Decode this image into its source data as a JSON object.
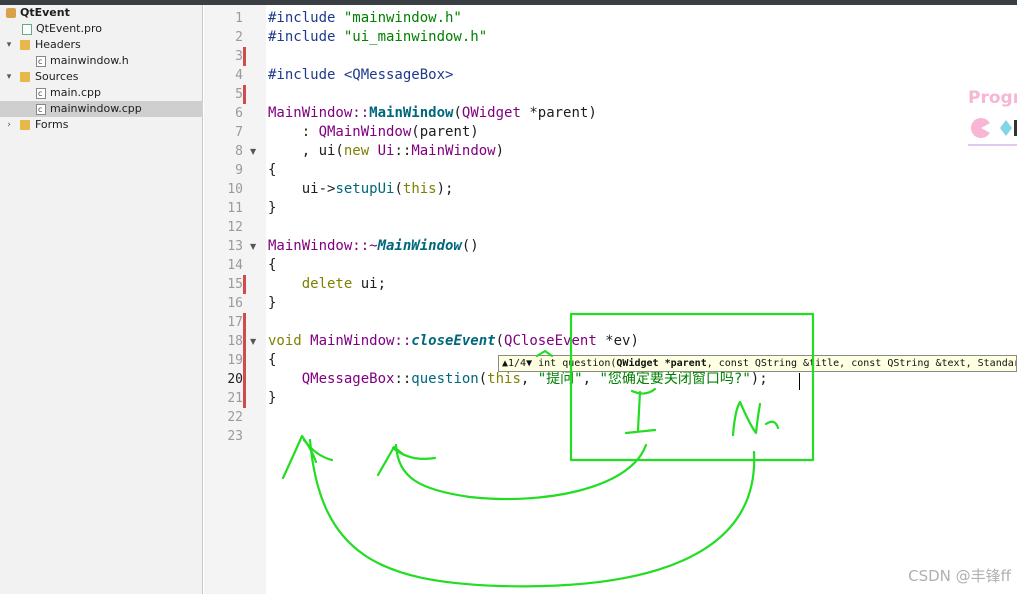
{
  "project_tree": {
    "project": "QtEvent",
    "pro_file": "QtEvent.pro",
    "headers_label": "Headers",
    "header_file": "mainwindow.h",
    "sources_label": "Sources",
    "source_main": "main.cpp",
    "source_mainwindow": "mainwindow.cpp",
    "forms_label": "Forms"
  },
  "line_numbers": [
    "1",
    "2",
    "3",
    "4",
    "5",
    "6",
    "7",
    "8",
    "9",
    "10",
    "11",
    "12",
    "13",
    "14",
    "15",
    "16",
    "17",
    "18",
    "19",
    "20",
    "21",
    "22",
    "23"
  ],
  "code": {
    "l1a": "#include ",
    "l1b": "\"mainwindow.h\"",
    "l2a": "#include ",
    "l2b": "\"ui_mainwindow.h\"",
    "l4": "#include <QMessageBox>",
    "l6a": "MainWindow::",
    "l6b": "MainWindow",
    "l6c": "(",
    "l6d": "QWidget",
    "l6e": " *parent)",
    "l7a": "    : ",
    "l7b": "QMainWindow",
    "l7c": "(parent)",
    "l8a": "    , ui(",
    "l8b": "new",
    "l8c": " ",
    "l8d": "Ui",
    "l8e": "::",
    "l8f": "MainWindow",
    "l8g": ")",
    "l9": "{",
    "l10a": "    ui->",
    "l10b": "setupUi",
    "l10c": "(",
    "l10d": "this",
    "l10e": ");",
    "l11": "}",
    "l13a": "MainWindow::~",
    "l13b": "MainWindow",
    "l13c": "()",
    "l14": "{",
    "l15a": "    ",
    "l15b": "delete",
    "l15c": " ui;",
    "l16": "}",
    "l18a": "void",
    "l18b": " MainWindow::",
    "l18c": "closeEvent",
    "l18d": "(",
    "l18e": "QCloseEvent",
    "l18f": " *ev)",
    "l19": "{",
    "l20a": "    ",
    "l20b": "QMessageBox",
    "l20c": "::",
    "l20d": "question",
    "l20e": "(",
    "l20f": "this",
    "l20g": ", ",
    "l20h": "\"提问\"",
    "l20i": ", ",
    "l20j": "\"您确定要关闭窗口吗?\"",
    "l20k": ");",
    "l21": "}"
  },
  "tooltip": {
    "counter": "▲1/4▼",
    "pre": " int question(",
    "bold": "QWidget *parent",
    "post": ", const QString &title, const QString &text, StandardButto"
  },
  "annotations": {
    "mark1": "1",
    "mark2": "N"
  },
  "logo_text": "Progr",
  "watermark": "CSDN @丰锋ff",
  "colors": {
    "annotation_green": "#22dd22",
    "change_marker": "#d24b4b"
  }
}
